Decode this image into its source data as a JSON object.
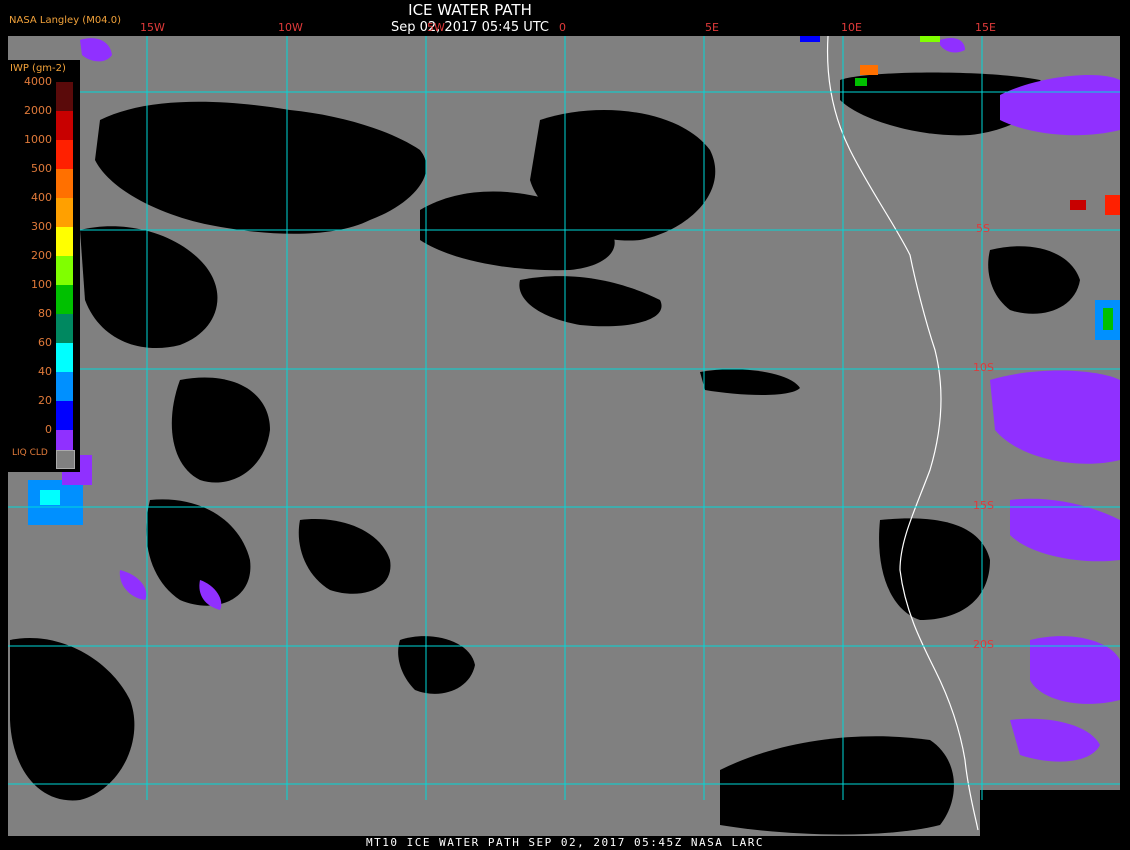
{
  "header": {
    "title": "ICE WATER PATH",
    "subtitle": "Sep 02, 2017 05:45 UTC",
    "org": "NASA Langley (M04.0)"
  },
  "footer": {
    "text": "MT10  ICE WATER PATH   SEP 02, 2017 05:45Z   NASA LARC"
  },
  "grid": {
    "lon_labels": [
      "15W",
      "10W",
      "5W",
      "0",
      "5E",
      "10E",
      "15E"
    ],
    "lat_labels": [
      "5S",
      "10S",
      "15S",
      "20S"
    ],
    "color": "#00d8d8"
  },
  "legend": {
    "title": "IWP (gm-2)",
    "ticks": [
      "4000",
      "2000",
      "1000",
      "500",
      "400",
      "300",
      "200",
      "100",
      "80",
      "60",
      "40",
      "20",
      "0"
    ],
    "colors": [
      "#5a0a0a",
      "#c80000",
      "#ff2000",
      "#ff7000",
      "#ffa000",
      "#ffff00",
      "#80ff00",
      "#00c000",
      "#008860",
      "#00ffff",
      "#0090ff",
      "#0000ff",
      "#9030ff"
    ],
    "liq_label": "LIQ CLD",
    "liq_color": "#808080"
  },
  "colors": {
    "clear": "#000000",
    "liquid_cloud": "#808080",
    "coastline": "#ffffff",
    "grid": "#00d8d8"
  }
}
